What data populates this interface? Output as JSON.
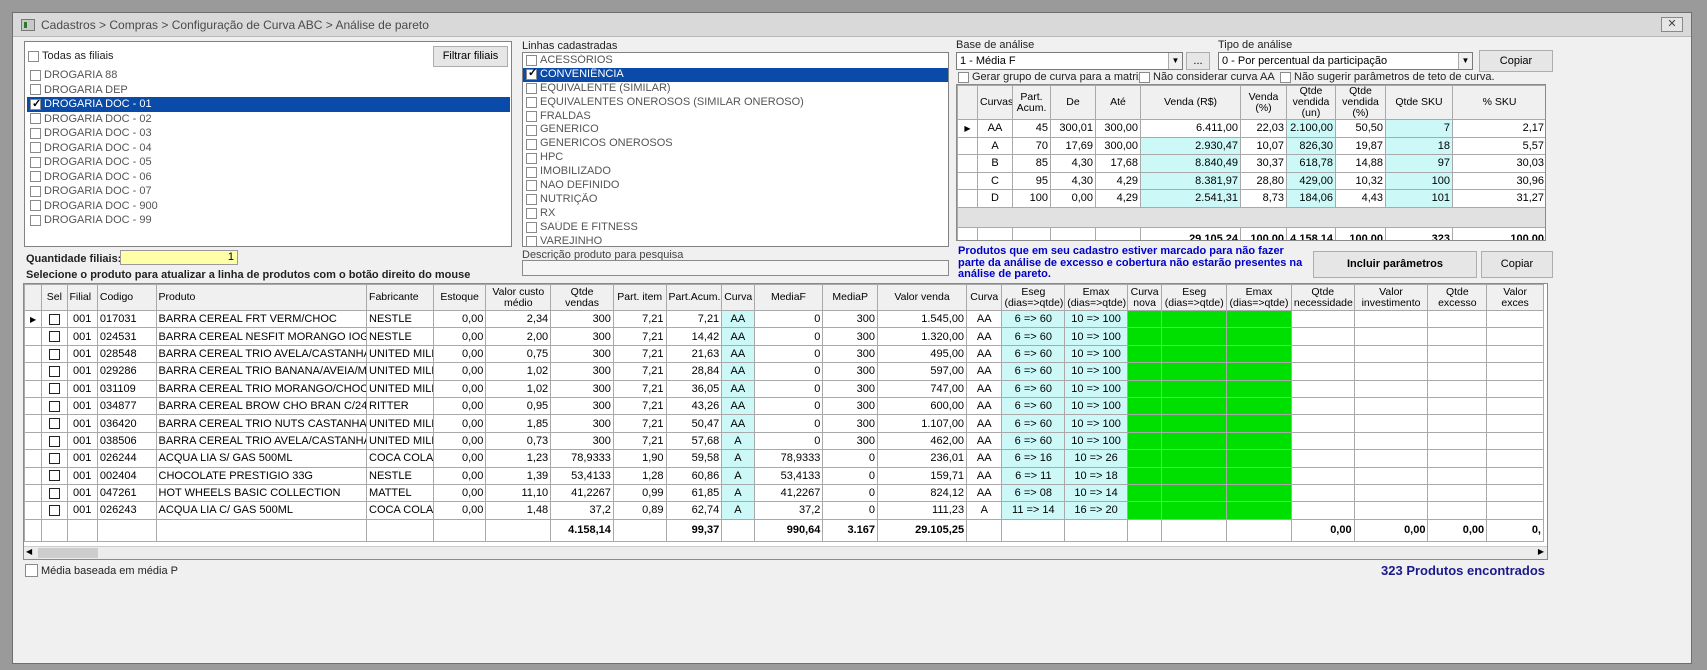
{
  "window": {
    "title": "Cadastros > Compras > Configuração de Curva ABC > Análise de pareto",
    "close": "✕"
  },
  "filiais": {
    "todas_label": "Todas as filiais",
    "filtrar_btn": "Filtrar filiais",
    "items": [
      {
        "label": "DROGARIA 88",
        "checked": false,
        "selected": false
      },
      {
        "label": "DROGARIA DEP",
        "checked": false,
        "selected": false
      },
      {
        "label": "DROGARIA DOC - 01",
        "checked": true,
        "selected": true
      },
      {
        "label": "DROGARIA DOC - 02",
        "checked": false,
        "selected": false
      },
      {
        "label": "DROGARIA DOC - 03",
        "checked": false,
        "selected": false
      },
      {
        "label": "DROGARIA DOC - 04",
        "checked": false,
        "selected": false
      },
      {
        "label": "DROGARIA DOC - 05",
        "checked": false,
        "selected": false
      },
      {
        "label": "DROGARIA DOC - 06",
        "checked": false,
        "selected": false
      },
      {
        "label": "DROGARIA DOC - 07",
        "checked": false,
        "selected": false
      },
      {
        "label": "DROGARIA DOC - 900",
        "checked": false,
        "selected": false
      },
      {
        "label": "DROGARIA DOC - 99",
        "checked": false,
        "selected": false
      }
    ],
    "quantidade_label": "Quantidade filiais:",
    "quantidade_value": "1",
    "hint": "Selecione o produto para atualizar a linha de produtos com o botão direito do mouse"
  },
  "linhas": {
    "label": "Linhas cadastradas",
    "items": [
      {
        "label": "ACESSÓRIOS",
        "checked": false,
        "selected": false
      },
      {
        "label": "CONVENIÊNCIA",
        "checked": true,
        "selected": true
      },
      {
        "label": "EQUIVALENTE (SIMILAR)",
        "checked": false,
        "selected": false
      },
      {
        "label": "EQUIVALENTES ONEROSOS (SIMILAR ONEROSO)",
        "checked": false,
        "selected": false
      },
      {
        "label": "FRALDAS",
        "checked": false,
        "selected": false
      },
      {
        "label": "GENERICO",
        "checked": false,
        "selected": false
      },
      {
        "label": "GENERICOS ONEROSOS",
        "checked": false,
        "selected": false
      },
      {
        "label": "HPC",
        "checked": false,
        "selected": false
      },
      {
        "label": "IMOBILIZADO",
        "checked": false,
        "selected": false
      },
      {
        "label": "NAO DEFINIDO",
        "checked": false,
        "selected": false
      },
      {
        "label": "NUTRIÇÃO",
        "checked": false,
        "selected": false
      },
      {
        "label": "RX",
        "checked": false,
        "selected": false
      },
      {
        "label": "SAÚDE E FITNESS",
        "checked": false,
        "selected": false
      },
      {
        "label": "VAREJINHO",
        "checked": false,
        "selected": false
      }
    ],
    "descricao_label": "Descrição produto para pesquisa",
    "descricao_value": ""
  },
  "analise": {
    "base_label": "Base de análise",
    "base_value": "1 - Média F",
    "ellipsis": "...",
    "tipo_label": "Tipo de análise",
    "tipo_value": "0 - Por percentual da participação",
    "copiar": "Copiar",
    "opt1": "Gerar grupo de curva para a matriz",
    "opt2": "Não considerar curva AA",
    "opt3": "Não sugerir parâmetros de teto de curva.",
    "headers": [
      "Curvas",
      "Part. Acum.",
      "De",
      "Até",
      "Venda (R$)",
      "Venda (%)",
      "Qtde vendida (un)",
      "Qtde vendida (%)",
      "Qtde SKU",
      "% SKU"
    ],
    "rows": [
      [
        "AA",
        "45",
        "300,01",
        "300,00",
        "6.411,00",
        "22,03",
        "2.100,00",
        "50,50",
        "7",
        "2,17"
      ],
      [
        "A",
        "70",
        "17,69",
        "300,00",
        "2.930,47",
        "10,07",
        "826,30",
        "19,87",
        "18",
        "5,57"
      ],
      [
        "B",
        "85",
        "4,30",
        "17,68",
        "8.840,49",
        "30,37",
        "618,78",
        "14,88",
        "97",
        "30,03"
      ],
      [
        "C",
        "95",
        "4,30",
        "4,29",
        "8.381,97",
        "28,80",
        "429,00",
        "10,32",
        "100",
        "30,96"
      ],
      [
        "D",
        "100",
        "0,00",
        "4,29",
        "2.541,31",
        "8,73",
        "184,06",
        "4,43",
        "101",
        "31,27"
      ]
    ],
    "totals": [
      "",
      "",
      "",
      "",
      "29.105,24",
      "100,00",
      "4.158,14",
      "100,00",
      "323",
      "100,00"
    ],
    "notice": "Produtos que em seu cadastro estiver marcado para não fazer parte da análise de excesso e cobertura não estarão presentes na análise de pareto.",
    "incluir_btn": "Incluir parâmetros",
    "copiar2": "Copiar"
  },
  "grid": {
    "headers": [
      "",
      "Sel",
      "Filial",
      "Codigo",
      "Produto",
      "Fabricante",
      "Estoque",
      "Valor custo médio",
      "Qtde vendas",
      "Part. item",
      "Part.Acum.",
      "Curva",
      "MediaF",
      "MediaP",
      "Valor venda",
      "Curva",
      "Eseg (dias=>qtde)",
      "Emax (dias=>qtde)",
      "Curva nova",
      "Eseg (dias=>qtde)",
      "Emax (dias=>qtde)",
      "Qtde necessidade",
      "Valor investimento",
      "Qtde excesso",
      "Valor exces"
    ],
    "rows": [
      [
        "001",
        "017031",
        "BARRA CEREAL FRT VERM/CHOC",
        "NESTLE",
        "0,00",
        "2,34",
        "300",
        "7,21",
        "7,21",
        "AA",
        "0",
        "300",
        "1.545,00",
        "AA",
        "6 => 60",
        "10 => 100"
      ],
      [
        "001",
        "024531",
        "BARRA CEREAL NESFIT  MORANGO IOG",
        "NESTLE",
        "0,00",
        "2,00",
        "300",
        "7,21",
        "14,42",
        "AA",
        "0",
        "300",
        "1.320,00",
        "AA",
        "6 => 60",
        "10 => 100"
      ],
      [
        "001",
        "028548",
        "BARRA CEREAL TRIO AVELA/CASTANHA/CI",
        "UNITED MILL",
        "0,00",
        "0,75",
        "300",
        "7,21",
        "21,63",
        "AA",
        "0",
        "300",
        "495,00",
        "AA",
        "6 => 60",
        "10 => 100"
      ],
      [
        "001",
        "029286",
        "BARRA CEREAL TRIO BANANA/AVEIA/MEL",
        "UNITED MILL",
        "0,00",
        "1,02",
        "300",
        "7,21",
        "28,84",
        "AA",
        "0",
        "300",
        "597,00",
        "AA",
        "6 => 60",
        "10 => 100"
      ],
      [
        "001",
        "031109",
        "BARRA CEREAL TRIO MORANGO/CHOCOLA",
        "UNITED MILL",
        "0,00",
        "1,02",
        "300",
        "7,21",
        "36,05",
        "AA",
        "0",
        "300",
        "747,00",
        "AA",
        "6 => 60",
        "10 => 100"
      ],
      [
        "001",
        "034877",
        "BARRA CEREAL BROW CHO BRAN C/24",
        "RITTER",
        "0,00",
        "0,95",
        "300",
        "7,21",
        "43,26",
        "AA",
        "0",
        "300",
        "600,00",
        "AA",
        "6 => 60",
        "10 => 100"
      ],
      [
        "001",
        "036420",
        "BARRA CEREAL TRIO NUTS CASTANHAS 30",
        "UNITED MILL",
        "0,00",
        "1,85",
        "300",
        "7,21",
        "50,47",
        "AA",
        "0",
        "300",
        "1.107,00",
        "AA",
        "6 => 60",
        "10 => 100"
      ],
      [
        "001",
        "038506",
        "BARRA CEREAL TRIO AVELA/CASTANHA/CI",
        "UNITED MILL",
        "0,00",
        "0,73",
        "300",
        "7,21",
        "57,68",
        "A",
        "0",
        "300",
        "462,00",
        "AA",
        "6 => 60",
        "10 => 100"
      ],
      [
        "001",
        "026244",
        "ACQUA LIA S/ GAS 500ML",
        "COCA COLA",
        "0,00",
        "1,23",
        "78,9333",
        "1,90",
        "59,58",
        "A",
        "78,9333",
        "0",
        "236,01",
        "AA",
        "6 => 16",
        "10 => 26"
      ],
      [
        "001",
        "002404",
        "CHOCOLATE PRESTIGIO 33G",
        "NESTLE",
        "0,00",
        "1,39",
        "53,4133",
        "1,28",
        "60,86",
        "A",
        "53,4133",
        "0",
        "159,71",
        "AA",
        "6 => 11",
        "10 => 18"
      ],
      [
        "001",
        "047261",
        "HOT WHEELS BASIC COLLECTION",
        "MATTEL",
        "0,00",
        "11,10",
        "41,2267",
        "0,99",
        "61,85",
        "A",
        "41,2267",
        "0",
        "824,12",
        "AA",
        "6 => 08",
        "10 => 14"
      ],
      [
        "001",
        "026243",
        "ACQUA LIA C/ GAS 500ML",
        "COCA COLA",
        "0,00",
        "1,48",
        "37,2",
        "0,89",
        "62,74",
        "A",
        "37,2",
        "0",
        "111,23",
        "A",
        "11 => 14",
        "16 => 20"
      ]
    ],
    "totals": {
      "qtde_vendas": "4.158,14",
      "part_acum": "99,37",
      "mediaf": "990,64",
      "mediap": "3.167",
      "valor_venda": "29.105,25",
      "qtde_necessidade": "0,00",
      "valor_investimento": "0,00",
      "qtde_excesso": "0,00",
      "valor_excesso": "0,"
    }
  },
  "footer": {
    "media_label": "Média baseada em média P",
    "count": "323 Produtos encontrados"
  },
  "colors": {
    "selection": "#0a4aa8",
    "cyan": "#ccf8f8",
    "green": "#00e000",
    "notice": "#0000c8"
  }
}
